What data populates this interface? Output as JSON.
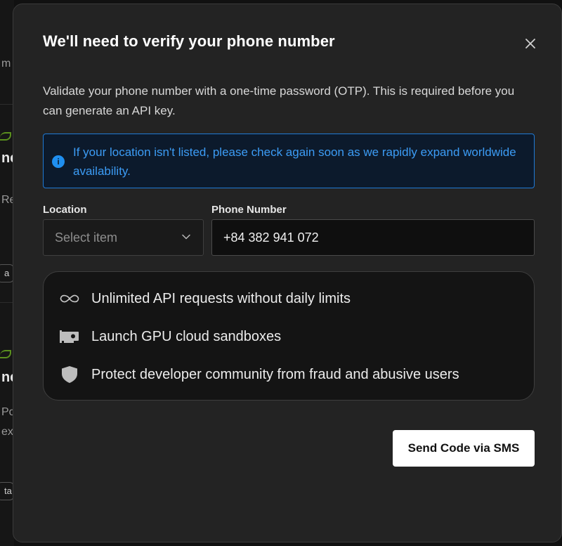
{
  "background": {
    "fragments": [
      "m",
      "ne",
      "Re",
      "a",
      "ne",
      "Po",
      "ex",
      "ta"
    ]
  },
  "modal": {
    "title": "We'll need to verify your phone number",
    "description": "Validate your phone number with a one-time password (OTP). This is required before you can generate an API key.",
    "info": {
      "icon": "info-icon",
      "text": "If your location isn't listed, please check again soon as we rapidly expand worldwide availability."
    },
    "location": {
      "label": "Location",
      "placeholder": "Select item"
    },
    "phone": {
      "label": "Phone Number",
      "value": "+84 382 941 072"
    },
    "features": [
      {
        "icon": "infinity-icon",
        "text": "Unlimited API requests without daily limits"
      },
      {
        "icon": "gpu-card-icon",
        "text": "Launch GPU cloud sandboxes"
      },
      {
        "icon": "shield-icon",
        "text": "Protect developer community from fraud and abusive users"
      }
    ],
    "send_button": "Send Code via SMS"
  },
  "colors": {
    "modal_bg": "#232323",
    "info_border": "#1f7ad6",
    "info_text": "#3c9cf5",
    "button_bg": "#ffffff"
  }
}
